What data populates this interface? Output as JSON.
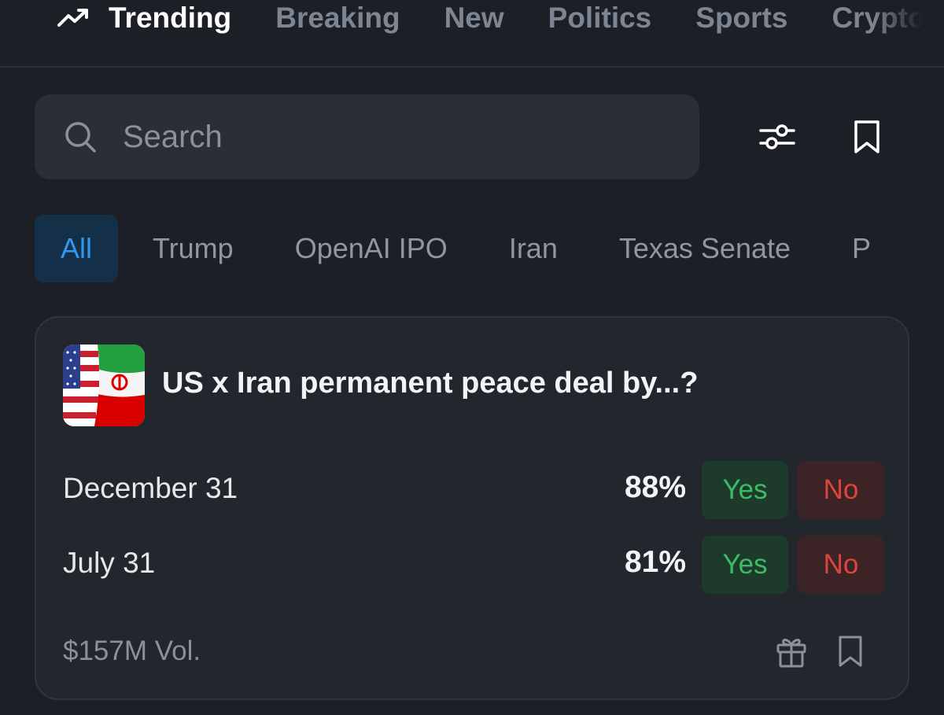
{
  "nav": {
    "items": [
      {
        "label": "Trending",
        "active": true,
        "icon": "trending-up-icon"
      },
      {
        "label": "Breaking",
        "active": false
      },
      {
        "label": "New",
        "active": false
      },
      {
        "label": "Politics",
        "active": false
      },
      {
        "label": "Sports",
        "active": false
      },
      {
        "label": "Crypto",
        "active": false
      }
    ]
  },
  "search": {
    "placeholder": "Search",
    "value": "",
    "icon": "search-icon"
  },
  "toolbar": {
    "filter_icon": "sliders-icon",
    "bookmark_icon": "bookmark-icon"
  },
  "chips": [
    {
      "label": "All",
      "active": true
    },
    {
      "label": "Trump",
      "active": false
    },
    {
      "label": "OpenAI IPO",
      "active": false
    },
    {
      "label": "Iran",
      "active": false
    },
    {
      "label": "Texas Senate",
      "active": false
    },
    {
      "label": "P",
      "active": false
    }
  ],
  "market": {
    "title": "US x Iran permanent peace deal by...?",
    "thumbnail": "us-iran-flags-image",
    "outcomes": [
      {
        "label": "December 31",
        "percent": "88%",
        "yes_label": "Yes",
        "no_label": "No"
      },
      {
        "label": "July 31",
        "percent": "81%",
        "yes_label": "Yes",
        "no_label": "No"
      }
    ],
    "volume": "$157M Vol.",
    "gift_icon": "gift-icon",
    "bookmark_icon": "bookmark-icon"
  },
  "colors": {
    "background": "#1c1f25",
    "card": "#22262d",
    "accent": "#2f97ef",
    "yes": "#3dbb66",
    "no": "#e0443e"
  }
}
